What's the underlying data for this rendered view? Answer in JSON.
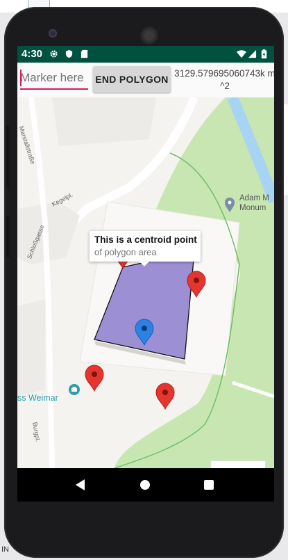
{
  "status_bar": {
    "time": "4:30",
    "icons": [
      "settings-gear-icon",
      "shield-icon",
      "sd-card-icon",
      "wifi-icon",
      "signal-icon",
      "battery-icon"
    ]
  },
  "toolbar": {
    "marker_placeholder": "Marker here",
    "end_polygon_label": "END POLYGON",
    "area_text": "3129.579695060743k m^2"
  },
  "map": {
    "roads": [
      "Marstallstraße",
      "Kegelpl.",
      "Schloßgasse",
      "Burgpl."
    ],
    "poi": {
      "name_line1": "Adam M",
      "name_line2": "Monum"
    },
    "weimar_label": "ss Weimar",
    "info_window": {
      "title": "This is a centroid point",
      "snippet": "of polygon area"
    },
    "colors": {
      "polygon_fill": "#9d8fd4",
      "marker_red": "#e5352e",
      "centroid_marker": "#2a82e4",
      "park_green": "#c8e6b1",
      "water": "#a8d4f3"
    }
  },
  "nav_bar": {
    "buttons": [
      "back-icon",
      "home-icon",
      "recents-icon"
    ]
  },
  "host": {
    "bottom_text": "IN"
  }
}
